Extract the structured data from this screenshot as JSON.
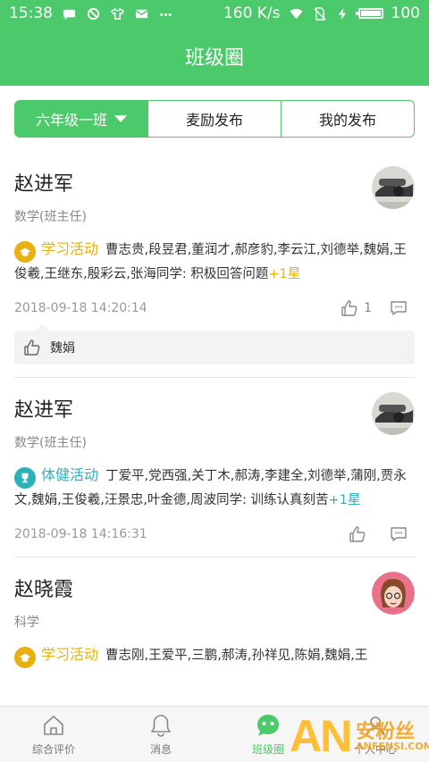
{
  "status_bar": {
    "time": "15:38",
    "speed": "160 K/s",
    "battery": "100",
    "battery_level": 1.0,
    "left_icons": [
      "message-bubble-icon",
      "dnd-icon",
      "tshirt-icon",
      "mail-icon",
      "more-icon"
    ],
    "right_icons": [
      "wifi-icon",
      "no-sim-icon",
      "charging-icon",
      "battery-icon"
    ]
  },
  "header": {
    "title": "班级圈"
  },
  "tabs": [
    {
      "label": "六年级一班",
      "active": true,
      "has_dropdown": true
    },
    {
      "label": "麦励发布",
      "active": false
    },
    {
      "label": "我的发布",
      "active": false
    }
  ],
  "colors": {
    "brand": "#4cc96a",
    "study": "#e8b010",
    "sport": "#2bb1b9"
  },
  "posts": [
    {
      "name": "赵进军",
      "role": "数学(班主任)",
      "avatar": "photo-avatar",
      "activity": "学习活动",
      "activity_icon": "mortarboard-icon",
      "content": "曹志贵,段昱君,董润才,郝彦豹,李云江,刘德举,魏娟,王俊羲,王继东,殷彩云,张海同学: 积极回答问题",
      "reward": "+1星",
      "time": "2018-09-18 14:20:14",
      "likes": "1",
      "liked_by": "魏娟"
    },
    {
      "name": "赵进军",
      "role": "数学(班主任)",
      "avatar": "photo-avatar",
      "activity": "体健活动",
      "activity_icon": "trophy-icon",
      "content": "丁爱平,党西强,关丁木,郝涛,李建全,刘德举,蒲刚,贾永文,魏娟,王俊羲,汪景忠,叶金德,周波同学: 训练认真刻苦",
      "reward": "+1星",
      "time": "2018-09-18 14:16:31"
    },
    {
      "name": "赵晓霞",
      "role": "科学",
      "avatar": "cartoon-girl-avatar",
      "activity": "学习活动",
      "activity_icon": "mortarboard-icon",
      "content": "曹志刚,王爱平,三鹏,郝涛,孙祥见,陈娟,魏娟,王"
    }
  ],
  "bottom_nav": [
    {
      "label": "综合评价",
      "icon": "home-icon",
      "active": false
    },
    {
      "label": "消息",
      "icon": "bell-icon",
      "active": false
    },
    {
      "label": "班级圈",
      "icon": "class-circle-icon",
      "active": true
    },
    {
      "label": "个人中心",
      "icon": "person-icon",
      "active": false
    }
  ],
  "watermark": {
    "mark": "AN",
    "name": "安粉丝",
    "site": "ANFENSI.COM"
  }
}
